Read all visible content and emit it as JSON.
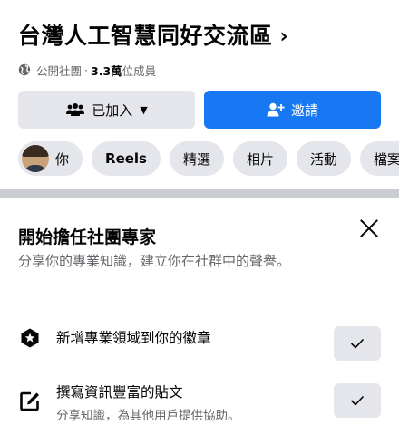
{
  "group": {
    "title": "台灣人工智慧同好交流區",
    "chevron": "›",
    "privacy": "公開社團",
    "separator": "·",
    "member_count": "3.3萬",
    "member_suffix": "位成員"
  },
  "actions": {
    "joined_label": "已加入",
    "invite_label": "邀請"
  },
  "chips": [
    {
      "label": "你"
    },
    {
      "label": "Reels"
    },
    {
      "label": "精選"
    },
    {
      "label": "相片"
    },
    {
      "label": "活動"
    },
    {
      "label": "檔案"
    }
  ],
  "expert_card": {
    "title": "開始擔任社團專家",
    "description": "分享你的專業知識，建立你在社群中的聲譽。",
    "tasks": [
      {
        "label": "新增專業領域到你的徽章",
        "sub": ""
      },
      {
        "label": "撰寫資訊豐富的貼文",
        "sub": "分享知識，為其他用戶提供協助。"
      }
    ]
  },
  "colors": {
    "accent": "#1877f2",
    "button_gray": "#e4e6eb",
    "secondary_text": "#65676b",
    "divider": "#c9ccd1"
  },
  "icons": {
    "privacy": "globe-icon",
    "joined": "group-people-icon",
    "invite": "add-person-icon",
    "close": "close-icon",
    "badge_task": "badge-star-icon",
    "post_task": "compose-icon",
    "check": "check-icon"
  }
}
